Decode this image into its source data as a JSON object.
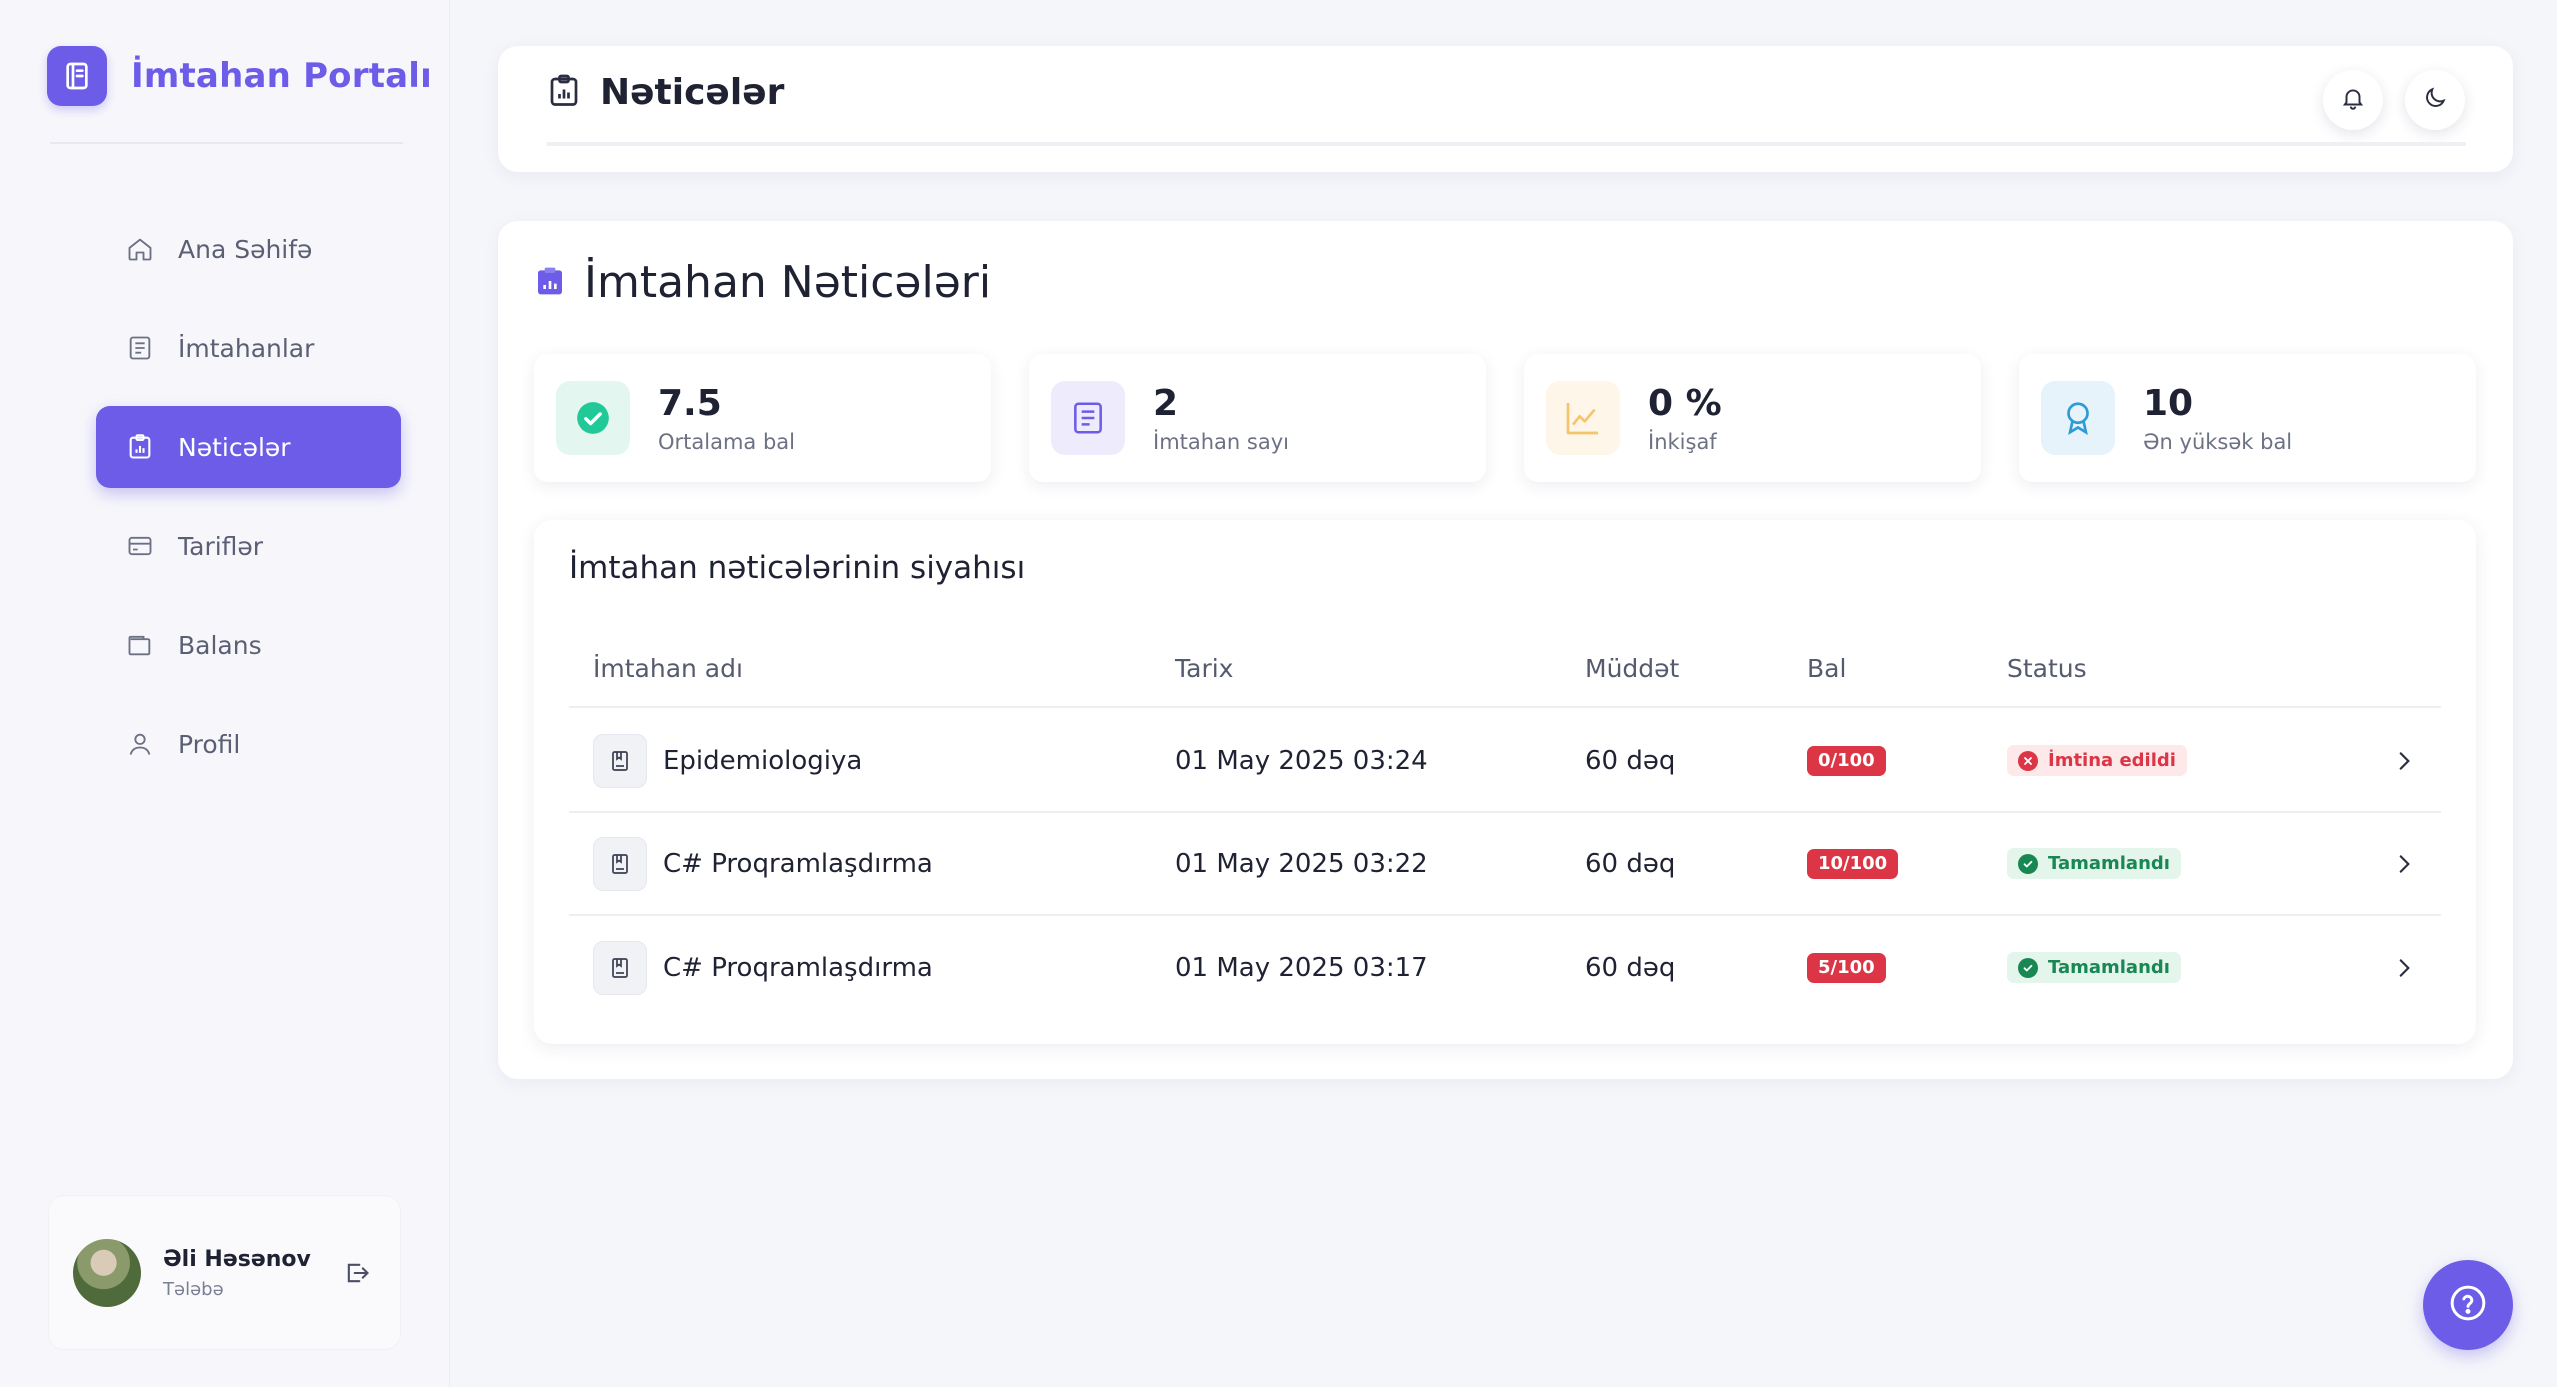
{
  "app": {
    "title": "İmtahan Portalı"
  },
  "sidebar": {
    "items": [
      {
        "label": "Ana Səhifə",
        "icon": "home-icon"
      },
      {
        "label": "İmtahanlar",
        "icon": "list-icon"
      },
      {
        "label": "Nəticələr",
        "icon": "clipboard-chart-icon",
        "active": true
      },
      {
        "label": "Tariflər",
        "icon": "credit-card-icon"
      },
      {
        "label": "Balans",
        "icon": "wallet-icon"
      },
      {
        "label": "Profil",
        "icon": "user-icon"
      }
    ]
  },
  "user": {
    "name": "Əli Həsənov",
    "role": "Tələbə"
  },
  "header": {
    "title": "Nəticələr"
  },
  "main": {
    "title": "İmtahan Nəticələri",
    "stats": [
      {
        "value": "7.5",
        "label": "Ortalama bal",
        "icon": "check-circle-icon",
        "color": "#20c997",
        "bg": "#e3f7f0"
      },
      {
        "value": "2",
        "label": "İmtahan sayı",
        "icon": "list-icon",
        "color": "#6c5ce7",
        "bg": "#eeecfc"
      },
      {
        "value": "0 %",
        "label": "İnkişaf",
        "icon": "trend-icon",
        "color": "#f5b041",
        "bg": "#fef6e8"
      },
      {
        "value": "10",
        "label": "Ən yüksək bal",
        "icon": "award-icon",
        "color": "#2e9bd6",
        "bg": "#e6f3fb"
      }
    ]
  },
  "table": {
    "title": "İmtahan nəticələrinin siyahısı",
    "columns": [
      "İmtahan adı",
      "Tarix",
      "Müddət",
      "Bal",
      "Status"
    ],
    "rows": [
      {
        "name": "Epidemiologiya",
        "date": "01 May 2025 03:24",
        "duration": "60 dəq",
        "score": "0/100",
        "status": "İmtina edildi",
        "status_type": "rejected"
      },
      {
        "name": "C# Proqramlaşdırma",
        "date": "01 May 2025 03:22",
        "duration": "60 dəq",
        "score": "10/100",
        "status": "Tamamlandı",
        "status_type": "completed"
      },
      {
        "name": "C# Proqramlaşdırma",
        "date": "01 May 2025 03:17",
        "duration": "60 dəq",
        "score": "5/100",
        "status": "Tamamlandı",
        "status_type": "completed"
      }
    ]
  },
  "colors": {
    "accent": "#6c5ce7",
    "danger": "#dc3545",
    "success": "#198754"
  }
}
